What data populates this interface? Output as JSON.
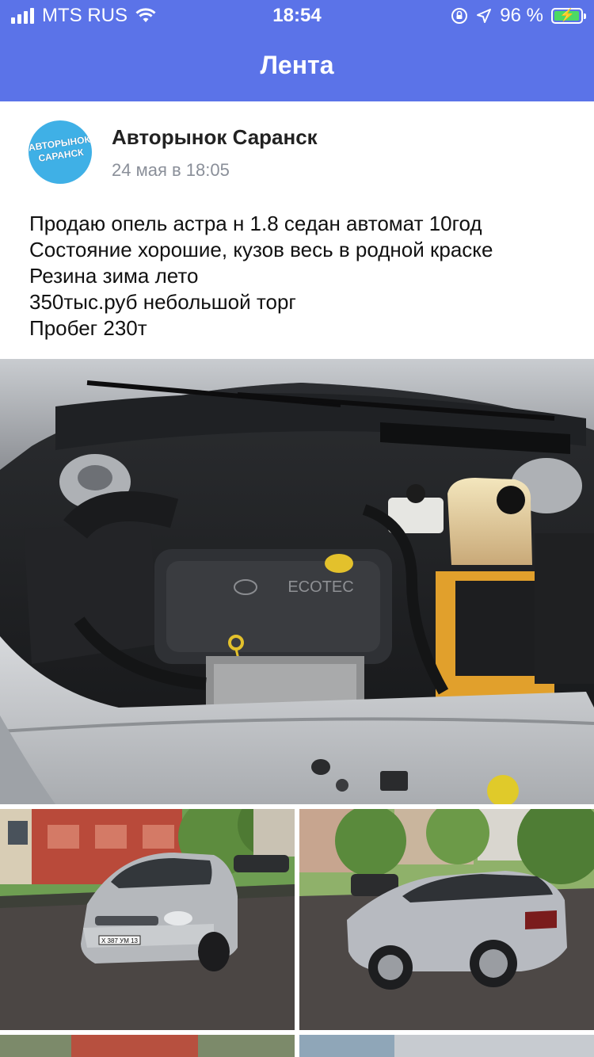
{
  "status_bar": {
    "carrier": "MTS RUS",
    "time": "18:54",
    "battery_percent": "96 %",
    "battery_level": 0.96,
    "icons": [
      "signal-icon",
      "wifi-icon",
      "orientation-lock-icon",
      "location-icon",
      "battery-icon"
    ]
  },
  "navbar": {
    "title": "Лента",
    "background": "#5b73e8"
  },
  "post": {
    "author": "Авторынок Саранск",
    "date": "24 мая в 18:05",
    "avatar_text_line1": "АВТОРЫНОК",
    "avatar_text_line2": "САРАНСК",
    "text_lines": [
      "Продаю опель астра н 1.8 седан автомат 10год",
      "Состояние хорошие, кузов весь в родной краске",
      "Резина зима лето",
      "350тыс.руб небольшой торг",
      "Пробег 230т"
    ],
    "photos": [
      {
        "name": "engine-bay-photo",
        "brand_text": "ECOTEC"
      },
      {
        "name": "car-front-photo",
        "plate_text": "Х 387 УМ 13"
      },
      {
        "name": "car-rear-photo"
      },
      {
        "name": "car-photo-4"
      },
      {
        "name": "car-photo-5"
      }
    ]
  }
}
